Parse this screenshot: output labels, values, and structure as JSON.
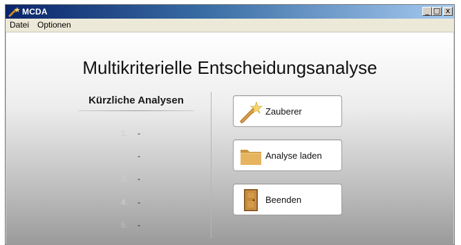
{
  "window": {
    "title": "MCDA",
    "controls": {
      "minimize": "_",
      "maximize": "□",
      "close": "x"
    }
  },
  "menu": {
    "items": [
      "Datei",
      "Optionen"
    ]
  },
  "main": {
    "title": "Multikriterielle Entscheidungsanalyse",
    "recent": {
      "heading": "Kürzliche Analysen",
      "items": [
        {
          "number": "1.",
          "value": "-"
        },
        {
          "number": "2.",
          "value": "-"
        },
        {
          "number": "3.",
          "value": "-"
        },
        {
          "number": "4.",
          "value": "-"
        },
        {
          "number": "5.",
          "value": "-"
        }
      ]
    },
    "actions": [
      {
        "label": "Zauberer",
        "icon": "magic-wand-icon"
      },
      {
        "label": "Analyse laden",
        "icon": "folder-icon"
      },
      {
        "label": "Beenden",
        "icon": "door-icon"
      }
    ]
  }
}
